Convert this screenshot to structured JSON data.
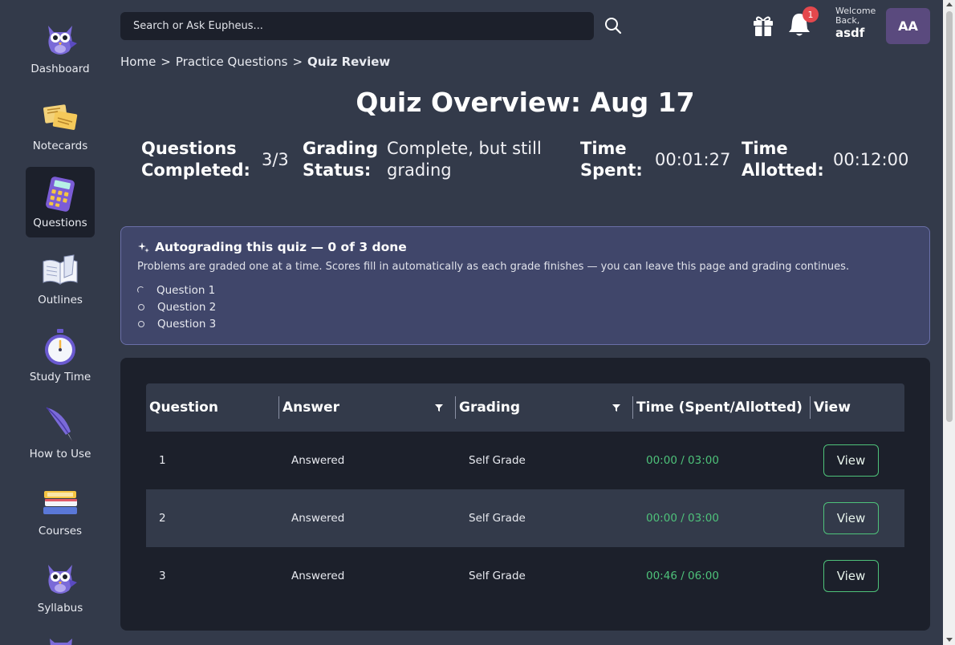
{
  "sidebar": {
    "items": [
      {
        "label": "Dashboard",
        "icon": "owl-icon"
      },
      {
        "label": "Notecards",
        "icon": "notecards-icon"
      },
      {
        "label": "Questions",
        "icon": "calculator-icon",
        "active": true
      },
      {
        "label": "Outlines",
        "icon": "open-book-icon"
      },
      {
        "label": "Study Time",
        "icon": "stopwatch-icon"
      },
      {
        "label": "How to Use",
        "icon": "quill-pen-icon"
      },
      {
        "label": "Courses",
        "icon": "book-stack-icon"
      },
      {
        "label": "Syllabus",
        "icon": "owl-icon"
      }
    ]
  },
  "header": {
    "search_placeholder": "Search or Ask Eupheus...",
    "notification_count": "1",
    "welcome_text": "Welcome Back,",
    "username": "asdf",
    "avatar_initials": "AA"
  },
  "breadcrumb": {
    "home": "Home",
    "section": "Practice Questions",
    "current": "Quiz Review",
    "separator": ">"
  },
  "page": {
    "title": "Quiz Overview: Aug 17"
  },
  "stats": {
    "completed_label": "Questions Completed:",
    "completed_value": "3/3",
    "grading_label": "Grading Status:",
    "grading_value": "Complete, but still grading",
    "spent_label": "Time Spent:",
    "spent_value": "00:01:27",
    "allotted_label": "Time Allotted:",
    "allotted_value": "00:12:00"
  },
  "autograde": {
    "title": "Autograding this quiz — 0 of 3 done",
    "description": "Problems are graded one at a time. Scores fill in automatically as each grade finishes — you can leave this page and grading continues.",
    "items": [
      {
        "label": "Question 1",
        "state": "in-progress"
      },
      {
        "label": "Question 2",
        "state": "pending"
      },
      {
        "label": "Question 3",
        "state": "pending"
      }
    ]
  },
  "table": {
    "headers": {
      "question": "Question",
      "answer": "Answer",
      "grading": "Grading",
      "time": "Time (Spent/Allotted)",
      "view": "View"
    },
    "rows": [
      {
        "question": "1",
        "answer": "Answered",
        "grading": "Self Grade",
        "time": "00:00 / 03:00",
        "view": "View"
      },
      {
        "question": "2",
        "answer": "Answered",
        "grading": "Self Grade",
        "time": "00:00 / 03:00",
        "view": "View"
      },
      {
        "question": "3",
        "answer": "Answered",
        "grading": "Self Grade",
        "time": "00:46 / 06:00",
        "view": "View"
      }
    ]
  },
  "colors": {
    "background": "#333a4a",
    "panel": "#1c202b",
    "accent_green": "#4ec27a",
    "badge_red": "#e5484d",
    "autograde_bg": "#40466a"
  }
}
